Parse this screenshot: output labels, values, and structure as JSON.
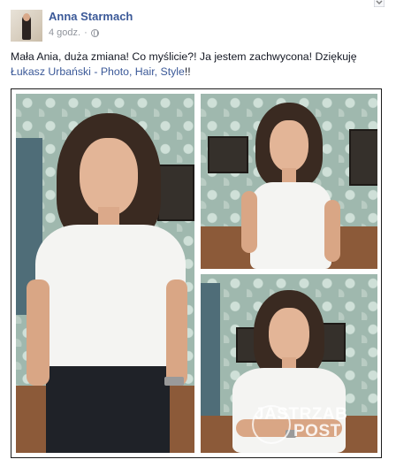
{
  "post": {
    "author": "Anna Starmach",
    "time": "4 godz."
  },
  "message": {
    "text": "Mała Ania, duża zmiana! Co myślicie?! Ja jestem zachwycona! Dziękuję ",
    "link": "Łukasz Urbański - Photo, Hair, Style",
    "suffix": "!!"
  },
  "photos": {
    "count": 3
  },
  "watermark": {
    "line1": "JASTRZAB",
    "line2": "POST"
  },
  "colors": {
    "link": "#3b5998",
    "meta": "#90949c",
    "text": "#141823"
  }
}
